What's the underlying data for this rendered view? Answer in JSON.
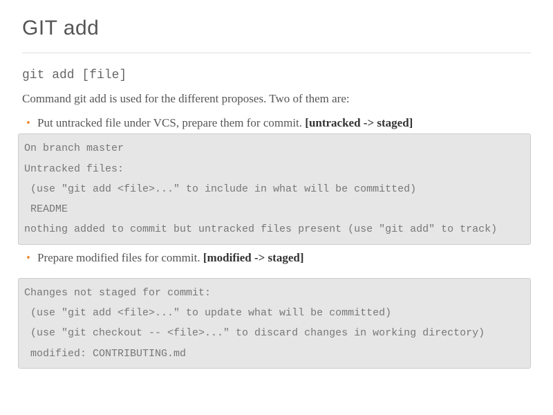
{
  "title": "GIT add",
  "command": "git add [file]",
  "intro": "Command git add is used for the different proposes. Two of them are:",
  "bullet1": {
    "text": "Put untracked file under VCS, prepare them for commit. ",
    "bold": "[untracked -> staged]"
  },
  "code1": "On branch master\nUntracked files:\n (use \"git add <file>...\" to include in what will be committed)\n README\nnothing added to commit but untracked files present (use \"git add\" to track)",
  "bullet2": {
    "text": "Prepare modified files for commit. ",
    "bold": "[modified -> staged]"
  },
  "code2": "Changes not staged for commit:\n (use \"git add <file>...\" to update what will be committed)\n (use \"git checkout -- <file>...\" to discard changes in working directory)\n modified: CONTRIBUTING.md"
}
